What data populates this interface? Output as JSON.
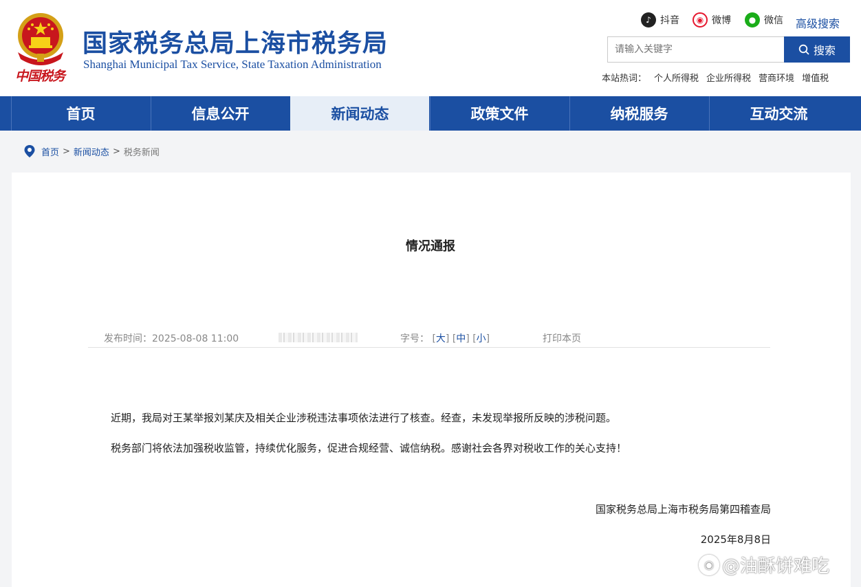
{
  "header": {
    "title_cn": "国家税务总局上海市税务局",
    "title_en": "Shanghai Municipal Tax Service, State Taxation Administration",
    "seal_text": "中国税务",
    "social": [
      {
        "label": "抖音",
        "icon": "douyin-icon",
        "color": "#222222"
      },
      {
        "label": "微博",
        "icon": "weibo-icon",
        "color": "#e6162d"
      },
      {
        "label": "微信",
        "icon": "wechat-icon",
        "color": "#1aad19"
      }
    ],
    "advanced_search": "高级搜索",
    "search_placeholder": "请输入关键字",
    "search_button": "搜索",
    "hot_label": "本站热词：",
    "hot_words": [
      "个人所得税",
      "企业所得税",
      "营商环境",
      "增值税"
    ]
  },
  "nav": {
    "items": [
      "首页",
      "信息公开",
      "新闻动态",
      "政策文件",
      "纳税服务",
      "互动交流"
    ],
    "active": "新闻动态"
  },
  "breadcrumb": {
    "items": [
      "首页",
      "新闻动态"
    ],
    "separator": ">",
    "current": "税务新闻"
  },
  "article": {
    "title": "情况通报",
    "publish_label": "发布时间：",
    "publish_time": "2025-08-08 11:00",
    "font_label": "字号：",
    "font_large": "大",
    "font_medium": "中",
    "font_small": "小",
    "print": "打印本页",
    "paragraphs": [
      "近期，我局对王某举报刘某庆及相关企业涉税违法事项依法进行了核查。经查，未发现举报所反映的涉税问题。",
      "税务部门将依法加强税收监管，持续优化服务，促进合规经营、诚信纳税。感谢社会各界对税收工作的关心支持！"
    ],
    "signature": "国家税务总局上海市税务局第四稽查局",
    "date": "2025年8月8日"
  },
  "watermark": "@油酥饼难吃",
  "colors": {
    "brand": "#1b4fa2",
    "nav_active_bg": "#e7eef7",
    "seal_red": "#c8161d"
  }
}
